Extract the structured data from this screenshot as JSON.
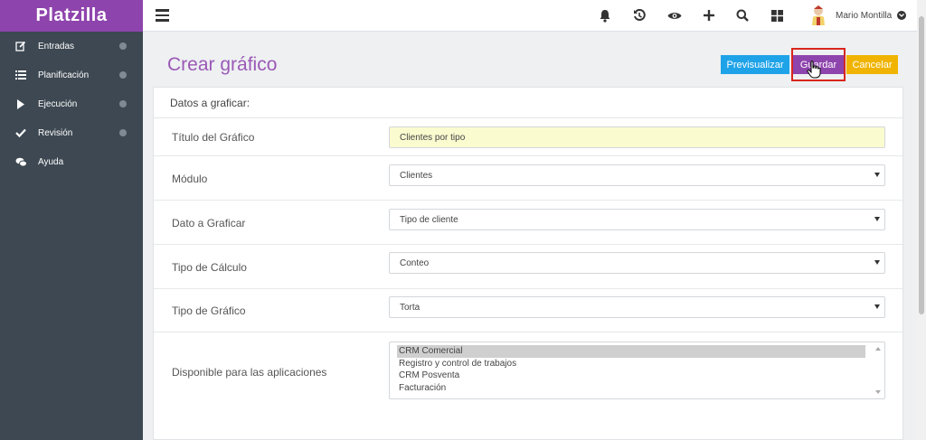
{
  "app": {
    "brand": "Platzilla"
  },
  "sidebar": {
    "items": [
      {
        "label": "Entradas",
        "icon": "edit-icon",
        "has_submenu": true
      },
      {
        "label": "Planificación",
        "icon": "list-icon",
        "has_submenu": true
      },
      {
        "label": "Ejecución",
        "icon": "play-icon",
        "has_submenu": true
      },
      {
        "label": "Revisión",
        "icon": "check-icon",
        "has_submenu": true
      },
      {
        "label": "Ayuda",
        "icon": "chat-icon",
        "has_submenu": false
      }
    ]
  },
  "topbar": {
    "icons": [
      "bell-icon",
      "history-icon",
      "eye-icon",
      "plus-icon",
      "search-icon",
      "grid-icon"
    ],
    "user_name": "Mario Montilla"
  },
  "page": {
    "title": "Crear gráfico",
    "buttons": {
      "preview": "Previsualizar",
      "save": "Guardar",
      "cancel": "Cancelar"
    }
  },
  "form": {
    "header": "Datos a graficar:",
    "chart_title": {
      "label": "Título del Gráfico",
      "value": "Clientes por tipo"
    },
    "module": {
      "label": "Módulo",
      "value": "Clientes"
    },
    "data_field": {
      "label": "Dato a Graficar",
      "value": "Tipo de cliente"
    },
    "calc_type": {
      "label": "Tipo de Cálculo",
      "value": "Conteo"
    },
    "chart_type": {
      "label": "Tipo de Gráfico",
      "value": "Torta"
    },
    "apps": {
      "label": "Disponible para las aplicaciones",
      "options": [
        "CRM Comercial",
        "Registro y control de trabajos",
        "CRM Posventa",
        "Facturación"
      ],
      "selected": "CRM Comercial"
    }
  },
  "colors": {
    "brand": "#8e44ad",
    "sidebar": "#3d4852",
    "preview_button": "#1fa3e8",
    "save_button": "#8e44ad",
    "cancel_button": "#f0b400",
    "title_field_bg": "#fbfbd0"
  }
}
